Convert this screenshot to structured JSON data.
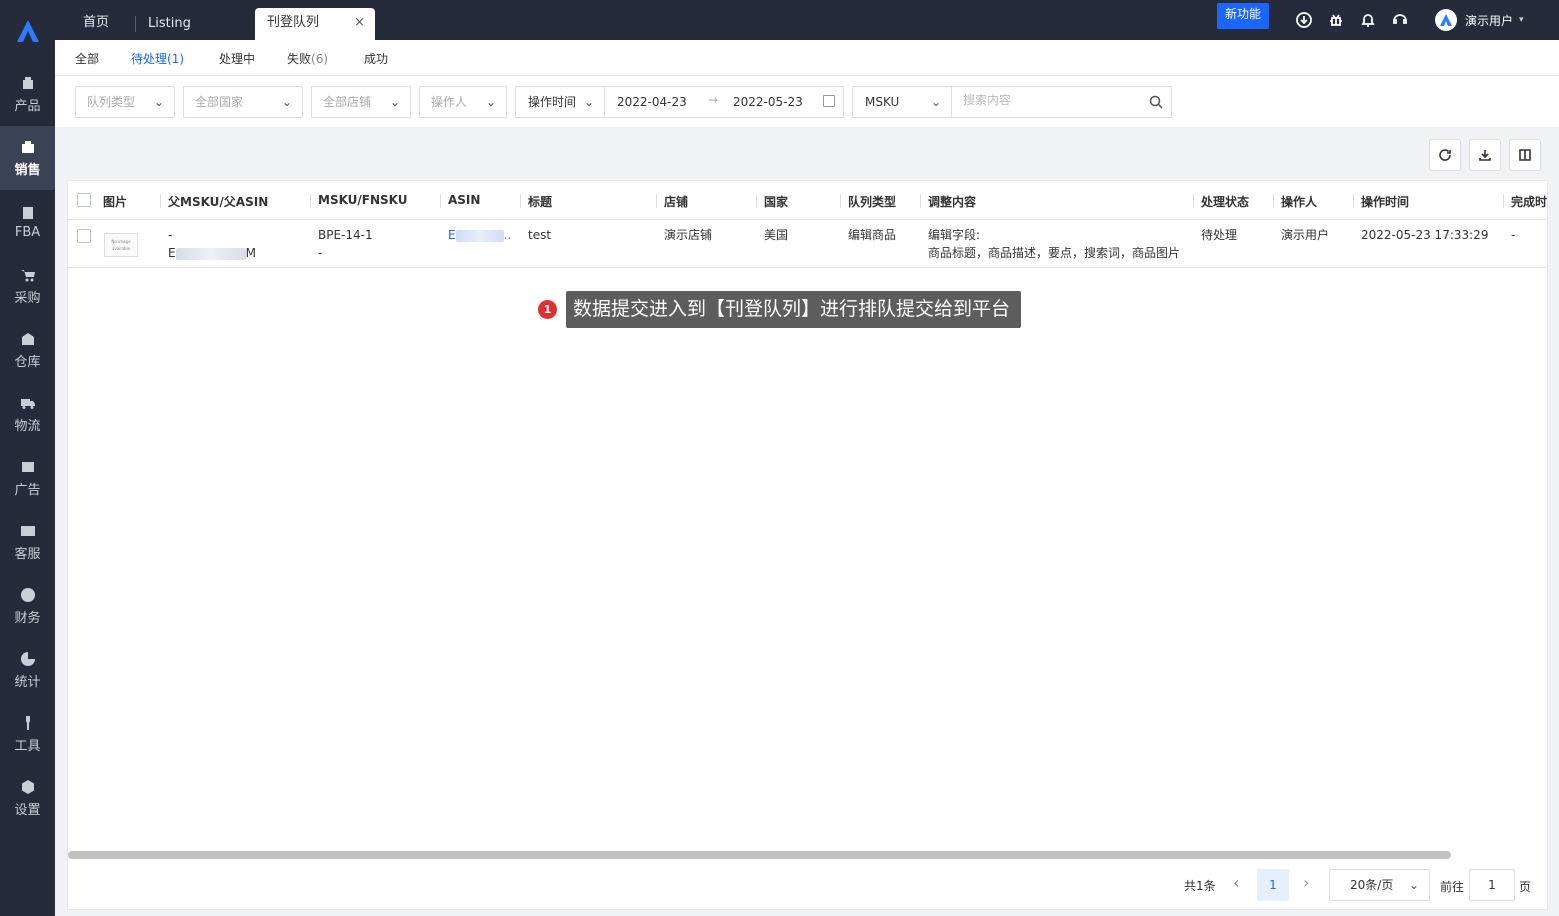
{
  "sidebar": {
    "items": [
      {
        "label": "产品",
        "icon": "box-icon"
      },
      {
        "label": "销售",
        "icon": "sell-icon",
        "active": true
      },
      {
        "label": "FBA",
        "icon": "fba-icon"
      },
      {
        "label": "采购",
        "icon": "cart-icon"
      },
      {
        "label": "仓库",
        "icon": "warehouse-icon"
      },
      {
        "label": "物流",
        "icon": "truck-icon"
      },
      {
        "label": "广告",
        "icon": "ad-icon"
      },
      {
        "label": "客服",
        "icon": "mail-icon"
      },
      {
        "label": "财务",
        "icon": "yen-icon"
      },
      {
        "label": "统计",
        "icon": "pie-icon"
      },
      {
        "label": "工具",
        "icon": "wrench-icon"
      },
      {
        "label": "设置",
        "icon": "settings-icon"
      }
    ]
  },
  "topbar": {
    "tabs": [
      "首页",
      "Listing",
      "刊登队列"
    ],
    "close_glyph": "×",
    "new_feature": "新功能",
    "user_name": "演示用户",
    "caret": "▾"
  },
  "status_tabs": [
    {
      "label": "全部",
      "count": ""
    },
    {
      "label": "待处理",
      "count": "(1)"
    },
    {
      "label": "处理中",
      "count": ""
    },
    {
      "label": "失败",
      "count": "(6)"
    },
    {
      "label": "成功",
      "count": ""
    }
  ],
  "filters": {
    "queue_type": "队列类型",
    "country": "全部国家",
    "store": "全部店铺",
    "operator": "操作人",
    "time_label": "操作时间",
    "date_from": "2022-04-23",
    "date_arrow": "→",
    "date_to": "2022-05-23",
    "search_field": "MSKU",
    "search_placeholder": "搜索内容",
    "chevron": "⌄"
  },
  "table": {
    "headers": [
      "图片",
      "父MSKU/父ASIN",
      "MSKU/FNSKU",
      "ASIN",
      "标题",
      "店铺",
      "国家",
      "队列类型",
      "调整内容",
      "处理状态",
      "操作人",
      "操作时间",
      "完成时"
    ],
    "row": {
      "thumb_text": "No image available",
      "parent_msku": "-",
      "parent_asin_start": "E",
      "parent_asin_end": "M",
      "msku": "BPE-14-1",
      "fnsku": "-",
      "asin_start": "E",
      "asin_end": "..",
      "title": "test",
      "store": "演示店铺",
      "country": "美国",
      "queue_type": "编辑商品",
      "adjust_line1": "编辑字段:",
      "adjust_line2": "商品标题，商品描述，要点，搜索词，商品图片",
      "status": "待处理",
      "operator": "演示用户",
      "op_time": "2022-05-23 17:33:29",
      "finish_time": "-"
    }
  },
  "annotation": {
    "number": "1",
    "text": "数据提交进入到【刊登队列】进行排队提交给到平台"
  },
  "pagination": {
    "total": "共1条",
    "prev": "‹",
    "page": "1",
    "next": "›",
    "page_size": "20条/页",
    "goto_label": "前往",
    "goto_value": "1",
    "page_suffix": "页"
  },
  "colors": {
    "primary": "#1a66ff",
    "sidebar_bg": "#252b3b",
    "annotation_bg": "#5d5d5d",
    "badge_red": "#e03131"
  }
}
